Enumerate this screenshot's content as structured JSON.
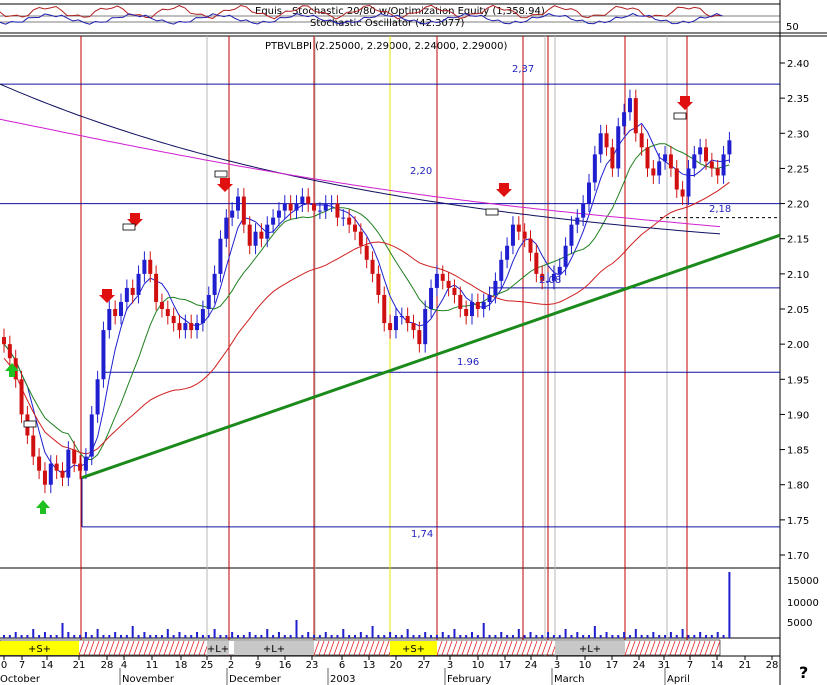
{
  "header": {
    "line1": "Equis - Stochastic 20/80 w/Optimization Equity (1,358.94)",
    "line2": "Stochastic Oscillator (42.3077)",
    "osc_tick": "50",
    "price_title": "PTBVLBPI (2.25000, 2.29000, 2.24000, 2.29000)"
  },
  "corner_mark": "?",
  "chart_data": {
    "type": "candlestick",
    "title": "PTBVLBPI (2.25000, 2.29000, 2.24000, 2.29000)",
    "ylim": [
      1.66,
      2.45
    ],
    "y_ticks": [
      "2.40",
      "2.35",
      "2.30",
      "2.25",
      "2.20",
      "2.15",
      "2.10",
      "2.05",
      "2.00",
      "1.95",
      "1.90",
      "1.85",
      "1.80",
      "1.75",
      "1.70"
    ],
    "volume_ticks": [
      "15000",
      "10000",
      "5000"
    ],
    "x_ticks": [
      "0",
      "7",
      "14",
      "21",
      "28",
      "4",
      "11",
      "18",
      "25",
      "2",
      "9",
      "16",
      "23",
      "6",
      "13",
      "20",
      "27",
      "3",
      "10",
      "17",
      "24",
      "3",
      "10",
      "17",
      "24",
      "31",
      "7",
      "14",
      "21",
      "28"
    ],
    "month_labels": [
      "October",
      "November",
      "December",
      "2003",
      "February",
      "March",
      "April"
    ],
    "levels": [
      {
        "label": "2,37",
        "value": 2.37
      },
      {
        "label": "2,20",
        "value": 2.2
      },
      {
        "label": "2,18",
        "value": 2.18
      },
      {
        "label": "2.08",
        "value": 2.08
      },
      {
        "label": "1.96",
        "value": 1.96
      },
      {
        "label": "1,74",
        "value": 1.74
      }
    ],
    "trendline": {
      "from": [
        22,
        1.81
      ],
      "to": [
        216,
        2.16
      ]
    },
    "signal_bands": [
      {
        "label": "+S+",
        "color": "yellow"
      },
      {
        "label": "+L+",
        "color": "gray"
      },
      {
        "label": "+L+",
        "color": "gray"
      },
      {
        "label": "+S+",
        "color": "yellow"
      },
      {
        "label": "+L+",
        "color": "gray"
      }
    ],
    "closes": [
      2.0,
      1.98,
      1.95,
      1.9,
      1.87,
      1.84,
      1.82,
      1.8,
      1.83,
      1.82,
      1.81,
      1.85,
      1.83,
      1.82,
      1.84,
      1.9,
      1.95,
      2.02,
      2.05,
      2.04,
      2.06,
      2.08,
      2.07,
      2.1,
      2.12,
      2.1,
      2.06,
      2.05,
      2.04,
      2.03,
      2.02,
      2.03,
      2.02,
      2.03,
      2.05,
      2.07,
      2.1,
      2.15,
      2.18,
      2.19,
      2.21,
      2.17,
      2.14,
      2.16,
      2.15,
      2.17,
      2.18,
      2.19,
      2.2,
      2.19,
      2.2,
      2.21,
      2.2,
      2.19,
      2.19,
      2.2,
      2.2,
      2.18,
      2.18,
      2.17,
      2.16,
      2.14,
      2.12,
      2.1,
      2.07,
      2.03,
      2.02,
      2.04,
      2.04,
      2.03,
      2.02,
      2.0,
      2.05,
      2.08,
      2.1,
      2.09,
      2.08,
      2.07,
      2.05,
      2.04,
      2.06,
      2.05,
      2.06,
      2.07,
      2.09,
      2.12,
      2.14,
      2.17,
      2.16,
      2.15,
      2.13,
      2.1,
      2.09,
      2.09,
      2.1,
      2.11,
      2.14,
      2.17,
      2.18,
      2.2,
      2.23,
      2.27,
      2.3,
      2.28,
      2.25,
      2.31,
      2.33,
      2.35,
      2.3,
      2.28,
      2.25,
      2.24,
      2.26,
      2.27,
      2.25,
      2.22,
      2.21,
      2.25,
      2.27,
      2.28,
      2.26,
      2.25,
      2.24,
      2.27,
      2.29
    ],
    "volume": [
      0.1,
      0.1,
      0.2,
      0.1,
      0.1,
      0.3,
      0.1,
      0.2,
      0.1,
      0.1,
      0.5,
      0.2,
      0.1,
      0.1,
      0.2,
      0.1,
      0.3,
      0.1,
      0.1,
      0.2,
      0.1,
      0.1,
      0.4,
      0.1,
      0.2,
      0.1,
      0.1,
      0.1,
      0.3,
      0.1,
      0.2,
      0.1,
      0.1,
      0.2,
      0.1,
      0.1,
      0.3,
      0.1,
      0.1,
      0.2,
      0.1,
      0.1,
      0.2,
      0.1,
      0.1,
      0.3,
      0.1,
      0.2,
      0.1,
      0.1,
      0.6,
      0.1,
      0.2,
      0.1,
      0.1,
      0.2,
      0.1,
      0.1,
      0.3,
      0.1,
      0.1,
      0.2,
      0.1,
      0.4,
      0.1,
      0.1,
      0.2,
      0.1,
      0.1,
      0.3,
      0.1,
      0.1,
      0.2,
      0.1,
      0.1,
      0.2,
      0.1,
      0.3,
      0.1,
      0.1,
      0.2,
      0.1,
      0.5,
      0.1,
      0.1,
      0.2,
      0.1,
      0.1,
      0.3,
      0.1,
      0.2,
      0.1,
      0.1,
      0.2,
      0.1,
      0.1,
      0.3,
      0.1,
      0.2,
      0.1,
      0.1,
      0.4,
      0.1,
      0.2,
      0.1,
      0.1,
      0.2,
      0.1,
      0.3,
      0.1,
      0.1,
      0.2,
      0.1,
      0.1,
      0.2,
      0.1,
      0.3,
      0.1,
      0.1,
      0.2,
      0.1,
      0.1,
      0.2,
      0.1,
      2.2
    ]
  }
}
